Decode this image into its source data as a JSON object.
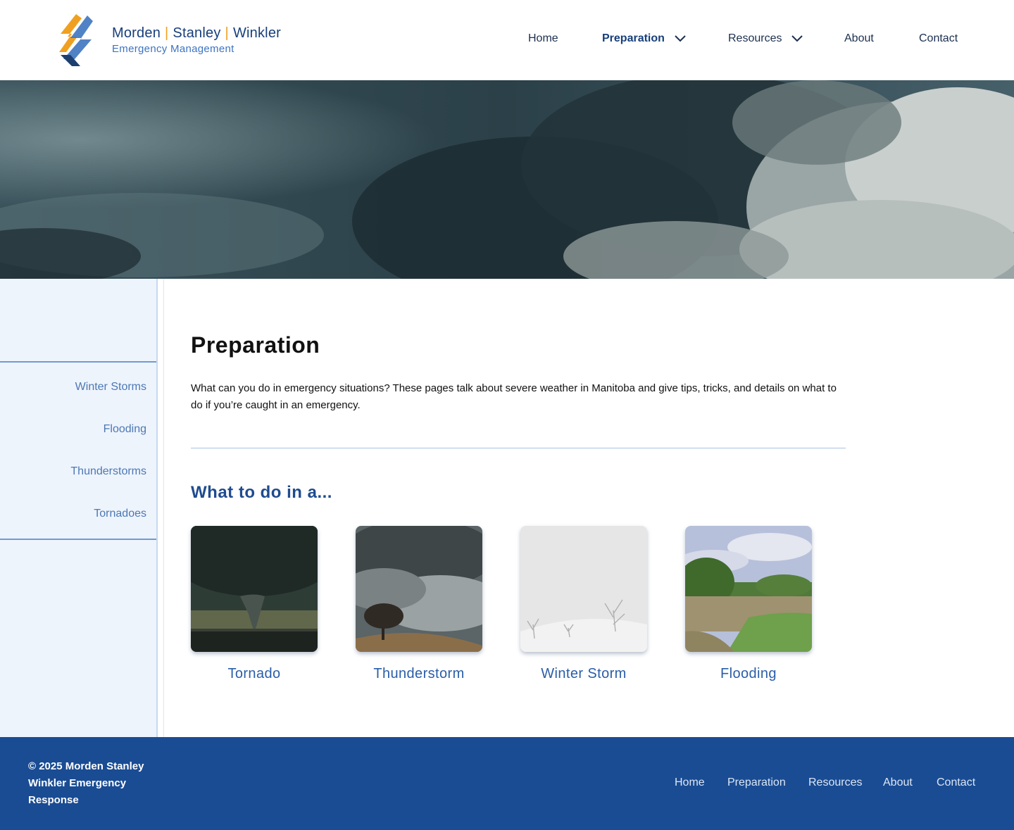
{
  "header": {
    "brand": {
      "name_1": "Morden",
      "name_2": "Stanley",
      "name_3": "Winkler",
      "separator": "|",
      "subtitle": "Emergency Management"
    },
    "nav": [
      {
        "label": "Home",
        "active": false,
        "dropdown": false
      },
      {
        "label": "Preparation",
        "active": true,
        "dropdown": true
      },
      {
        "label": "Resources",
        "active": false,
        "dropdown": true
      },
      {
        "label": "About",
        "active": false,
        "dropdown": false
      },
      {
        "label": "Contact",
        "active": false,
        "dropdown": false
      }
    ]
  },
  "sidebar": {
    "items": [
      {
        "label": "Winter Storms"
      },
      {
        "label": "Flooding"
      },
      {
        "label": "Thunderstorms"
      },
      {
        "label": "Tornadoes"
      }
    ]
  },
  "main": {
    "title": "Preparation",
    "intro": "What can you do in emergency situations? These pages talk about severe weather in Manitoba and give tips, tricks, and details on what to do if you’re caught in an emergency.",
    "subheading": "What to do in a...",
    "cards": [
      {
        "label": "Tornado",
        "image": "tornado-photo"
      },
      {
        "label": "Thunderstorm",
        "image": "thunderstorm-photo"
      },
      {
        "label": "Winter Storm",
        "image": "winter-storm-photo"
      },
      {
        "label": "Flooding",
        "image": "flooding-photo"
      }
    ]
  },
  "footer": {
    "copyright": "© 2025 Morden Stanley Winkler Emergency Response",
    "links": [
      {
        "label": "Home"
      },
      {
        "label": "Preparation"
      },
      {
        "label": "Resources"
      },
      {
        "label": "About"
      },
      {
        "label": "Contact"
      }
    ]
  },
  "colors": {
    "primary": "#1a4c93",
    "accent": "#f0a020",
    "link": "#4c78b4",
    "sidebar_bg": "#eef4fc"
  }
}
